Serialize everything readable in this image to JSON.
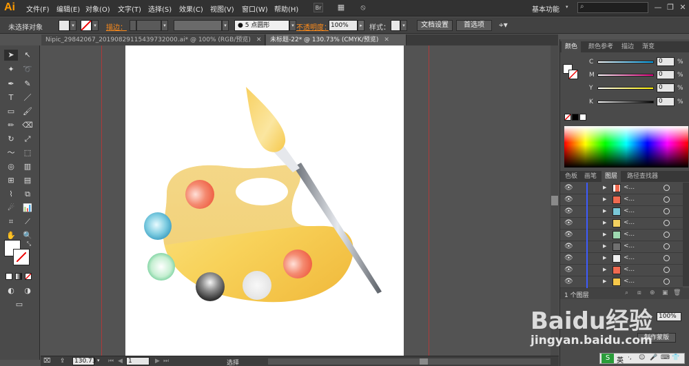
{
  "app": {
    "logo": "Ai",
    "workspace": "基本功能"
  },
  "menu": [
    "文件(F)",
    "编辑(E)",
    "对象(O)",
    "文字(T)",
    "选择(S)",
    "效果(C)",
    "视图(V)",
    "窗口(W)",
    "帮助(H)"
  ],
  "control_bar": {
    "selection_label": "未选择对象",
    "stroke_label": "描边：",
    "brush_label": "5 点圆形",
    "opacity_label": "不透明度：",
    "opacity_value": "100%",
    "style_label": "样式：",
    "doc_setup_button": "文档设置",
    "preferences_button": "首选项"
  },
  "tabs": [
    {
      "label": "Nipic_29842067_20190829115439732000.ai* @ 100% (RGB/预览)",
      "active": false
    },
    {
      "label": "未标题-22* @ 130.73% (CMYK/预览)",
      "active": true
    }
  ],
  "status_bar": {
    "zoom": "130.73",
    "artboard": "1",
    "tool": "选择"
  },
  "color_panel": {
    "tabs": [
      "颜色",
      "颜色参考",
      "描边",
      "渐变"
    ],
    "sliders": [
      {
        "label": "C",
        "value": "0",
        "unit": "%",
        "color": "#00a0e9"
      },
      {
        "label": "M",
        "value": "0",
        "unit": "%",
        "color": "#e4007f"
      },
      {
        "label": "Y",
        "value": "0",
        "unit": "%",
        "color": "#fff100"
      },
      {
        "label": "K",
        "value": "0",
        "unit": "%",
        "color": "#000000"
      }
    ]
  },
  "layers_panel": {
    "tabs": [
      "色板",
      "画笔",
      "图层",
      "路径查找器"
    ],
    "rows": [
      {
        "name": "<...",
        "swatch": "#f06a50"
      },
      {
        "name": "<...",
        "swatch": "#f06a50"
      },
      {
        "name": "<...",
        "swatch": "#7ac8d8"
      },
      {
        "name": "<...",
        "swatch": "#f2d060"
      },
      {
        "name": "<...",
        "swatch": "#9ed8b0"
      },
      {
        "name": "<...",
        "swatch": "#707070"
      },
      {
        "name": "<...",
        "swatch": "#eeeeee"
      },
      {
        "name": "<...",
        "swatch": "#f06a50"
      },
      {
        "name": "<...",
        "swatch": "#f7c84a"
      }
    ],
    "footer": "1 个图层"
  },
  "transparency_panel": {
    "opacity_value": "100%",
    "make_mask_button": "制作蒙版"
  },
  "watermark": {
    "brand": "Baidu经验",
    "url": "jingyan.baidu.com"
  },
  "ime": {
    "lang": "英"
  }
}
